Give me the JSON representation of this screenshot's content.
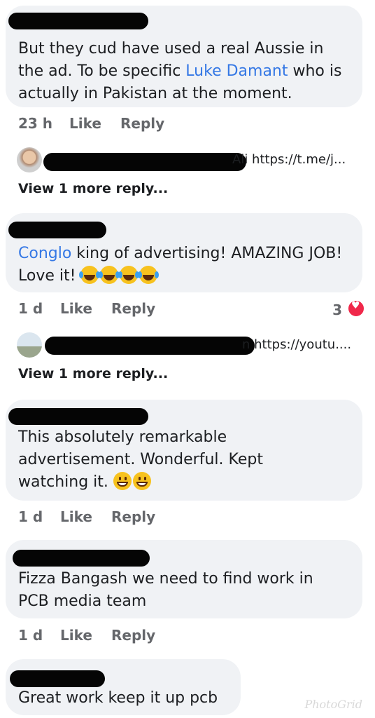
{
  "comments": [
    {
      "text_before": "But they cud have used a real Aussie in the ad. To be specific ",
      "mention": "Luke Damant",
      "text_after": " who is actually in Pakistan at the moment.",
      "time": "23 h",
      "like": "Like",
      "reply": "Reply"
    },
    {
      "mention": "Conglo",
      "text_after": "  king of advertising! AMAZING JOB! Love it!",
      "emoji_icons": [
        "laughing-crying-icon",
        "laughing-crying-icon",
        "laughing-crying-icon",
        "laughing-crying-icon"
      ],
      "time": "1 d",
      "like": "Like",
      "reply": "Reply",
      "reaction_count": "3",
      "reaction_icon": "heart-icon"
    },
    {
      "text": "This absolutely remarkable advertisement. Wonderful. Kept watching it.",
      "emoji_icons": [
        "grinning-face-icon",
        "grinning-face-icon"
      ],
      "time": "1 d",
      "like": "Like",
      "reply": "Reply"
    },
    {
      "text": "Fizza Bangash we need to find work in PCB media team",
      "time": "1 d",
      "like": "Like",
      "reply": "Reply"
    },
    {
      "text": "Great work keep it up pcb"
    }
  ],
  "reply_previews": [
    {
      "visible_text": "Ali https://t.me/j...",
      "view_more": "View 1 more reply..."
    },
    {
      "visible_text": "n https://youtu....",
      "view_more": "View 1 more reply..."
    }
  ],
  "watermark": "PhotoGrid",
  "colors": {
    "bubble": "#f0f2f5",
    "mention": "#3578e5",
    "meta": "#65676b",
    "heart": "#f0284a"
  }
}
